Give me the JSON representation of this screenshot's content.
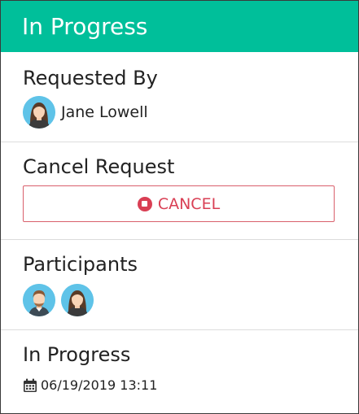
{
  "colors": {
    "accent": "#00bf9a",
    "danger": "#d93f54"
  },
  "header": {
    "title": "In Progress"
  },
  "requested_by": {
    "title": "Requested By",
    "user": {
      "name": "Jane Lowell",
      "avatar": "female-avatar-icon"
    }
  },
  "cancel_request": {
    "title": "Cancel Request",
    "button_label": "CANCEL",
    "button_icon": "stop-circle-icon"
  },
  "participants": {
    "title": "Participants",
    "avatars": [
      "male-avatar-icon",
      "female-avatar-icon"
    ]
  },
  "status": {
    "title": "In Progress",
    "icon": "calendar-icon",
    "timestamp": "06/19/2019 13:11"
  }
}
